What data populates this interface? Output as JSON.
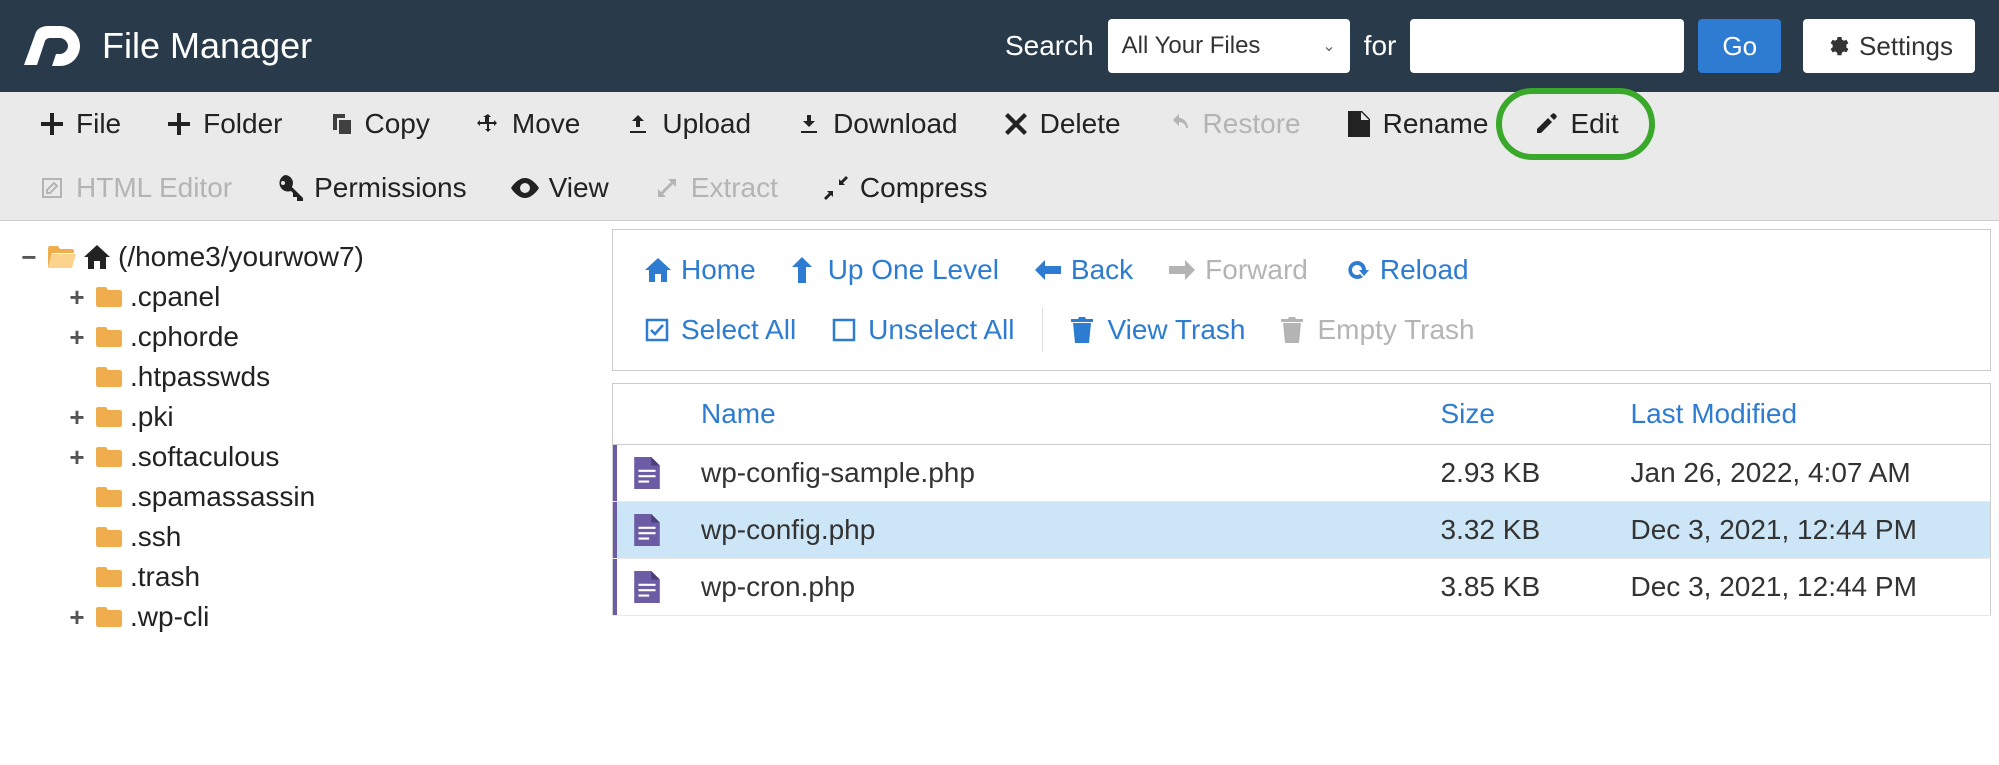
{
  "header": {
    "app_title": "File Manager",
    "search_label": "Search",
    "for_label": "for",
    "search_scope": "All Your Files",
    "search_value": "",
    "go_label": "Go",
    "settings_label": "Settings"
  },
  "toolbar": {
    "file": "File",
    "folder": "Folder",
    "copy": "Copy",
    "move": "Move",
    "upload": "Upload",
    "download": "Download",
    "delete": "Delete",
    "restore": "Restore",
    "rename": "Rename",
    "edit": "Edit",
    "html_editor": "HTML Editor",
    "permissions": "Permissions",
    "view": "View",
    "extract": "Extract",
    "compress": "Compress"
  },
  "tree": {
    "root_label": "(/home3/yourwow7)",
    "items": [
      {
        "label": ".cpanel",
        "expandable": true
      },
      {
        "label": ".cphorde",
        "expandable": true
      },
      {
        "label": ".htpasswds",
        "expandable": false
      },
      {
        "label": ".pki",
        "expandable": true
      },
      {
        "label": ".softaculous",
        "expandable": true
      },
      {
        "label": ".spamassassin",
        "expandable": false
      },
      {
        "label": ".ssh",
        "expandable": false
      },
      {
        "label": ".trash",
        "expandable": false
      },
      {
        "label": ".wp-cli",
        "expandable": true
      }
    ]
  },
  "nav": {
    "home": "Home",
    "up": "Up One Level",
    "back": "Back",
    "forward": "Forward",
    "reload": "Reload",
    "select_all": "Select All",
    "unselect_all": "Unselect All",
    "view_trash": "View Trash",
    "empty_trash": "Empty Trash"
  },
  "table": {
    "columns": {
      "name": "Name",
      "size": "Size",
      "modified": "Last Modified"
    },
    "rows": [
      {
        "name": "wp-config-sample.php",
        "size": "2.93 KB",
        "modified": "Jan 26, 2022, 4:07 AM",
        "selected": false
      },
      {
        "name": "wp-config.php",
        "size": "3.32 KB",
        "modified": "Dec 3, 2021, 12:44 PM",
        "selected": true
      },
      {
        "name": "wp-cron.php",
        "size": "3.85 KB",
        "modified": "Dec 3, 2021, 12:44 PM",
        "selected": false
      }
    ]
  }
}
